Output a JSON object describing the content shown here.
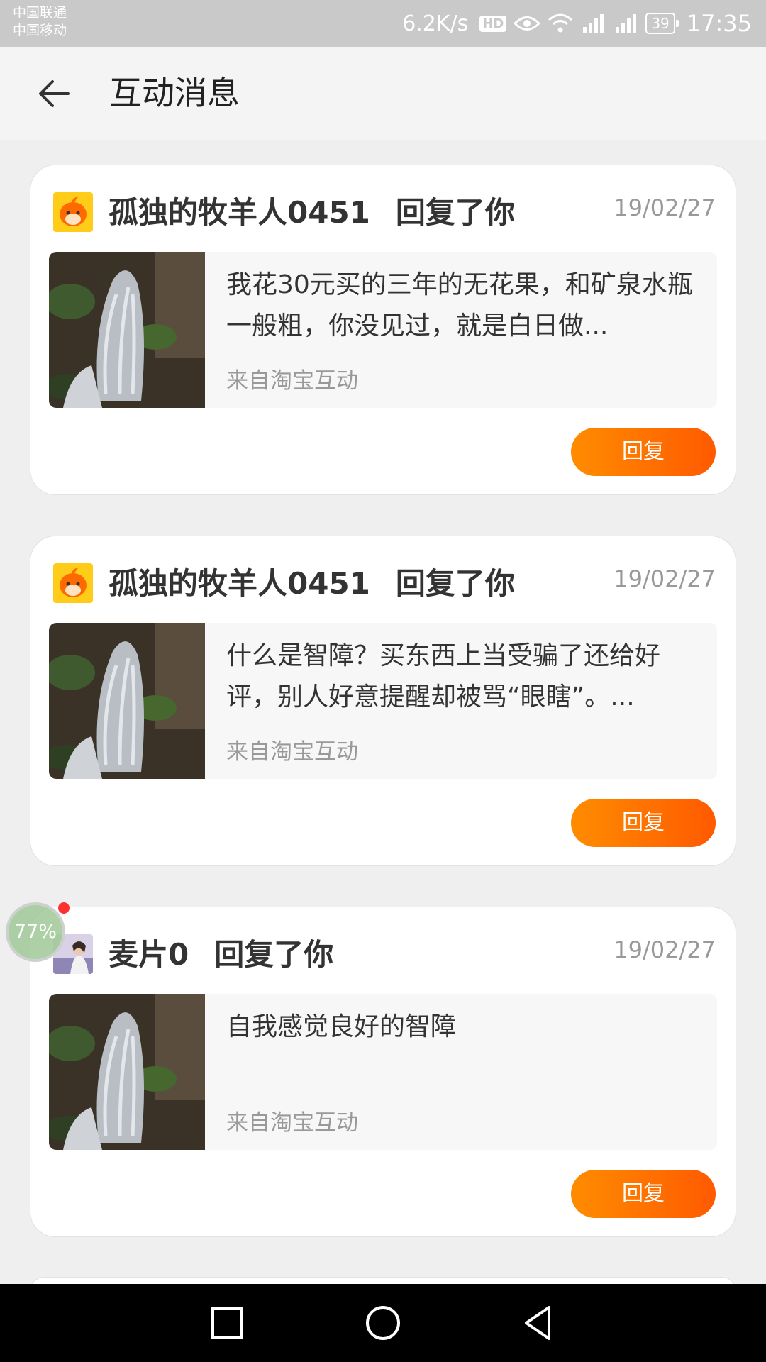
{
  "status_bar": {
    "carrier_1": "中国联通",
    "carrier_2": "中国移动",
    "net_speed": "6.2K/s",
    "hd_label": "HD",
    "battery": "39",
    "time": "17:35"
  },
  "header": {
    "title": "互动消息"
  },
  "messages": [
    {
      "author": "孤独的牧羊人0451",
      "action": "回复了你",
      "date": "19/02/27",
      "text": "我花30元买的三年的无花果，和矿泉水瓶一般粗，你没见过，就是白日做...",
      "source": "来自淘宝互动",
      "reply_label": "回复",
      "avatar_icon": "orange-mascot-avatar"
    },
    {
      "author": "孤独的牧羊人0451",
      "action": "回复了你",
      "date": "19/02/27",
      "text": "什么是智障？买东西上当受骗了还给好评，别人好意提醒却被骂“眼瞎”。...",
      "source": "来自淘宝互动",
      "reply_label": "回复",
      "avatar_icon": "orange-mascot-avatar"
    },
    {
      "author": "麦片0",
      "action": "回复了你",
      "date": "19/02/27",
      "text": "自我感觉良好的智障",
      "source": "来自淘宝互动",
      "reply_label": "回复",
      "avatar_icon": "photo-avatar"
    }
  ],
  "float_widget": {
    "label": "77%"
  },
  "colors": {
    "accent_start": "#ff8c00",
    "accent_end": "#ff5a00"
  }
}
